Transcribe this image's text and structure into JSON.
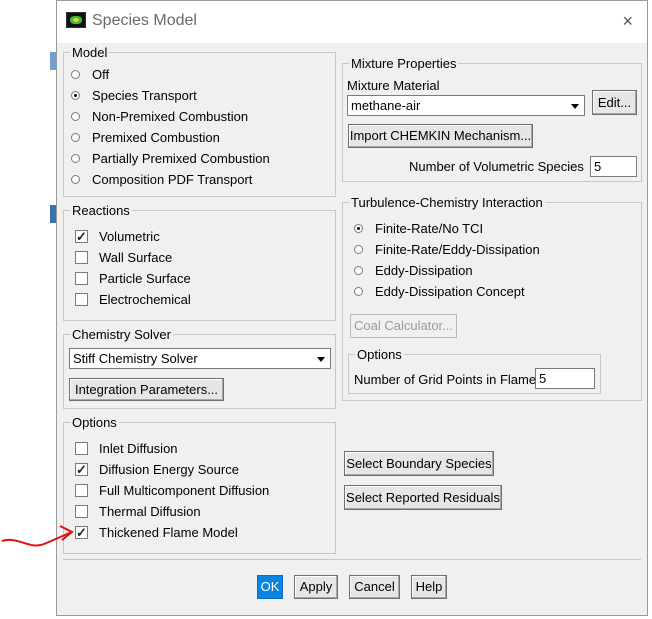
{
  "window": {
    "title": "Species Model",
    "close_icon": "×"
  },
  "model": {
    "legend": "Model",
    "options": [
      {
        "label": "Off",
        "selected": false
      },
      {
        "label": "Species Transport",
        "selected": true
      },
      {
        "label": "Non-Premixed Combustion",
        "selected": false
      },
      {
        "label": "Premixed Combustion",
        "selected": false
      },
      {
        "label": "Partially Premixed Combustion",
        "selected": false
      },
      {
        "label": "Composition PDF Transport",
        "selected": false
      }
    ]
  },
  "reactions": {
    "legend": "Reactions",
    "items": [
      {
        "label": "Volumetric",
        "checked": true
      },
      {
        "label": "Wall Surface",
        "checked": false
      },
      {
        "label": "Particle Surface",
        "checked": false
      },
      {
        "label": "Electrochemical",
        "checked": false
      }
    ]
  },
  "chemistry_solver": {
    "legend": "Chemistry Solver",
    "selected": "Stiff Chemistry Solver",
    "integration_button": "Integration Parameters..."
  },
  "options": {
    "legend": "Options",
    "items": [
      {
        "label": "Inlet Diffusion",
        "checked": false
      },
      {
        "label": "Diffusion Energy Source",
        "checked": true
      },
      {
        "label": "Full Multicomponent Diffusion",
        "checked": false
      },
      {
        "label": "Thermal Diffusion",
        "checked": false
      },
      {
        "label": "Thickened Flame Model",
        "checked": true
      }
    ]
  },
  "mixture_properties": {
    "legend": "Mixture Properties",
    "material_label": "Mixture Material",
    "material_value": "methane-air",
    "edit_button": "Edit...",
    "import_button": "Import CHEMKIN Mechanism...",
    "species_label": "Number of Volumetric Species",
    "species_value": "5"
  },
  "turbulence_chemistry": {
    "legend": "Turbulence-Chemistry Interaction",
    "options": [
      {
        "label": "Finite-Rate/No TCI",
        "selected": true
      },
      {
        "label": "Finite-Rate/Eddy-Dissipation",
        "selected": false
      },
      {
        "label": "Eddy-Dissipation",
        "selected": false
      },
      {
        "label": "Eddy-Dissipation Concept",
        "selected": false
      }
    ],
    "coal_button": "Coal Calculator...",
    "options_legend": "Options",
    "grid_points_label": "Number of Grid Points in Flame",
    "grid_points_value": "5"
  },
  "side_buttons": {
    "boundary": "Select Boundary Species",
    "residuals": "Select Reported Residuals"
  },
  "footer": {
    "ok": "OK",
    "apply": "Apply",
    "cancel": "Cancel",
    "help": "Help"
  },
  "colors": {
    "accent": "#0a84e0",
    "annotation_arrow": "#e01010"
  }
}
